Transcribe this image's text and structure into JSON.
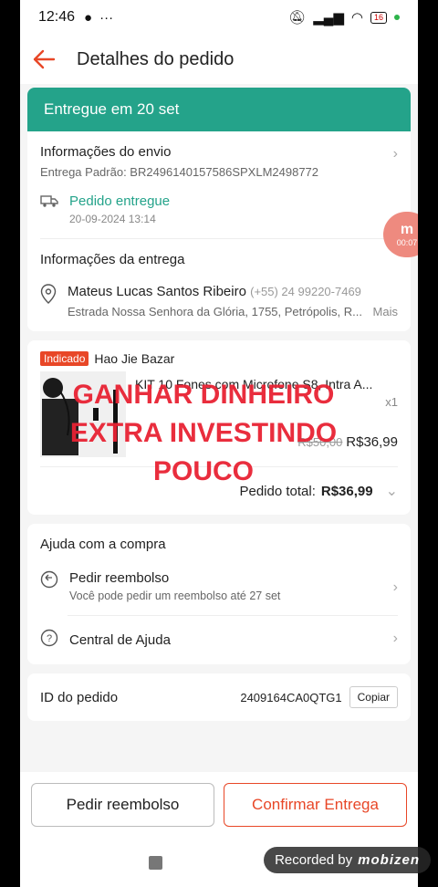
{
  "status": {
    "time": "12:46",
    "battery": "16"
  },
  "header": {
    "title": "Detalhes do pedido"
  },
  "banner": {
    "text": "Entregue em 20 set"
  },
  "shipping": {
    "title": "Informações do envio",
    "tracking": "Entrega Padrão: BR2496140157586SPXLM2498772",
    "status": "Pedido entregue",
    "datetime": "20-09-2024 13:14"
  },
  "delivery": {
    "title": "Informações da entrega",
    "name": "Mateus Lucas Santos Ribeiro",
    "phone": "(+55) 24 99220-7469",
    "address": "Estrada Nossa Senhora da Glória, 1755, Petrópolis, R...",
    "more": "Mais"
  },
  "shop": {
    "badge": "Indicado",
    "name": "Hao Jie Bazar",
    "product": "KIT 10 Fones com Microfone S8, Intra A...",
    "qty": "x1",
    "old_price": "R$50,00",
    "price": "R$36,99",
    "total_label": "Pedido total:",
    "total_value": "R$36,99"
  },
  "overlay": {
    "line1": "GANHAR DINHEIRO",
    "line2": "EXTRA INVESTINDO",
    "line3": "POUCO"
  },
  "help": {
    "title": "Ajuda com a compra",
    "refund": "Pedir reembolso",
    "refund_sub": "Você pode pedir um reembolso até 27 set",
    "center": "Central de Ajuda"
  },
  "order": {
    "label": "ID do pedido",
    "id": "2409164CA0QTG1",
    "copy": "Copiar"
  },
  "actions": {
    "refund": "Pedir reembolso",
    "confirm": "Confirmar Entrega"
  },
  "recorder": {
    "text": "Recorded by",
    "brand": "mobizen"
  },
  "bubble": {
    "time": "00:07"
  }
}
